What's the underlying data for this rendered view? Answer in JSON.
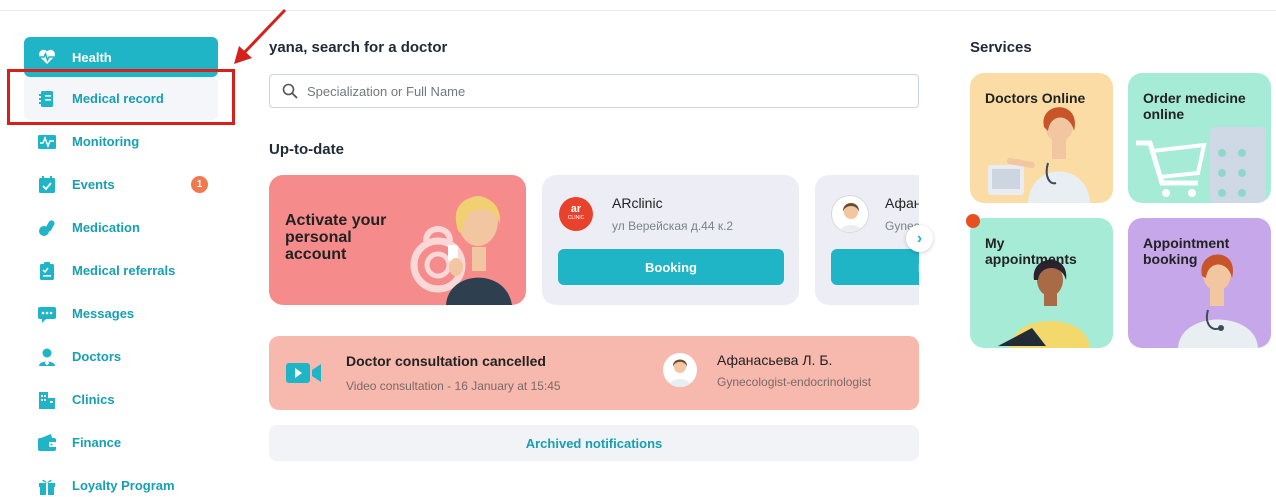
{
  "sidebar": {
    "items": [
      {
        "label": "Health",
        "icon": "heart-pulse-icon"
      },
      {
        "label": "Medical record",
        "icon": "medical-record-icon"
      },
      {
        "label": "Monitoring",
        "icon": "monitoring-icon"
      },
      {
        "label": "Events",
        "icon": "calendar-icon",
        "badge": "1"
      },
      {
        "label": "Medication",
        "icon": "pills-icon"
      },
      {
        "label": "Medical referrals",
        "icon": "referral-icon"
      },
      {
        "label": "Messages",
        "icon": "chat-icon"
      },
      {
        "label": "Doctors",
        "icon": "doctor-icon"
      },
      {
        "label": "Clinics",
        "icon": "clinic-icon"
      },
      {
        "label": "Finance",
        "icon": "wallet-icon"
      },
      {
        "label": "Loyalty Program",
        "icon": "gift-icon"
      }
    ]
  },
  "main": {
    "greeting": "yana, search for a doctor",
    "search_placeholder": "Specialization or Full Name",
    "section_title": "Up-to-date",
    "activate_card": {
      "text": "Activate your personal account"
    },
    "clinic_card": {
      "logo_text": "ar",
      "logo_sub": "CLINIC",
      "name": "ARclinic",
      "address": "ул Верейская д.44 к.2",
      "button": "Booking"
    },
    "doctor_card": {
      "name": "Афанасьева Л. Б.",
      "spec": "Gynecologist-endocrinologist",
      "button": "Booking"
    },
    "notification": {
      "title": "Doctor consultation cancelled",
      "subtitle": "Video consultation - 16 January at 15:45",
      "doctor_name": "Афанасьева Л. Б.",
      "doctor_spec": "Gynecologist-endocrinologist"
    },
    "archive_label": "Archived notifications"
  },
  "services": {
    "title": "Services",
    "items": [
      {
        "label": "Doctors Online"
      },
      {
        "label": "Order medicine online"
      },
      {
        "label": "My appointments"
      },
      {
        "label": "Appointment booking"
      }
    ]
  },
  "colors": {
    "accent": "#1fb5c6",
    "badge": "#f07a4e",
    "highlight_annotation": "#d6201c"
  }
}
